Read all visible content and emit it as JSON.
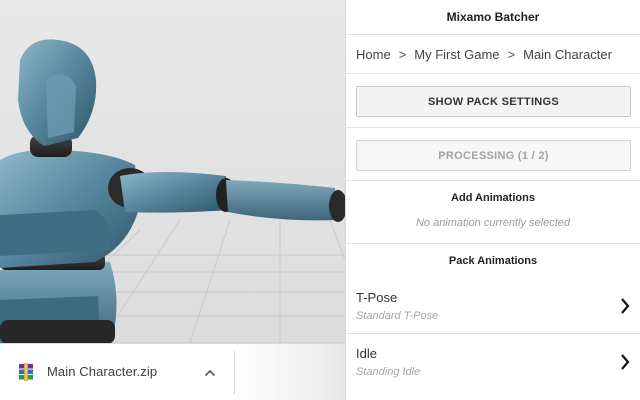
{
  "viewport": {
    "character_color": "#4f7f96",
    "floor_color": "#dcdcdc"
  },
  "download_bar": {
    "file_name": "Main Character.zip",
    "file_icon": "winrar-archive-icon",
    "menu_icon": "chevron-up-icon"
  },
  "panel": {
    "title": "Mixamo Batcher",
    "breadcrumb": {
      "items": [
        "Home",
        "My First Game",
        "Main Character"
      ],
      "separator": ">"
    },
    "show_pack_settings_label": "SHOW PACK SETTINGS",
    "processing_label": "PROCESSING (1 / 2)",
    "add_animations": {
      "title": "Add Animations",
      "empty_text": "No animation currently selected"
    },
    "pack_animations": {
      "title": "Pack Animations",
      "items": [
        {
          "name": "T-Pose",
          "description": "Standard T-Pose"
        },
        {
          "name": "Idle",
          "description": "Standing Idle"
        }
      ]
    }
  }
}
